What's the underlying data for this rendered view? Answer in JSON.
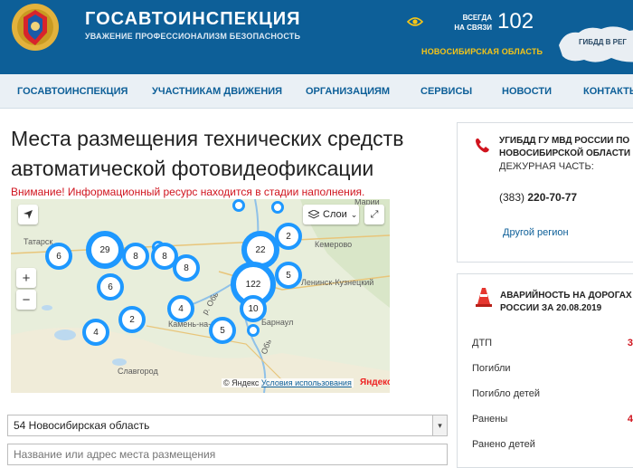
{
  "header": {
    "title": "ГОСАВТОИНСПЕКЦИЯ",
    "subtitle": "УВАЖЕНИЕ ПРОФЕССИОНАЛИЗМ БЕЗОПАСНОСТЬ",
    "contact_label_line1": "ВСЕГДА",
    "contact_label_line2": "НА СВЯЗИ",
    "contact_number": "102",
    "region": "НОВОСИБИРСКАЯ ОБЛАСТЬ",
    "map_caption": "ГИБДД В РЕГ"
  },
  "nav": {
    "items": [
      "ГОСАВТОИНСПЕКЦИЯ",
      "УЧАСТНИКАМ ДВИЖЕНИЯ",
      "ОРГАНИЗАЦИЯМ",
      "СЕРВИСЫ",
      "НОВОСТИ",
      "КОНТАКТЫ"
    ]
  },
  "main": {
    "title": "Места размещения технических средств автоматической фотовидеофиксации",
    "warning": "Внимание! Информационный ресурс находится в стадии наполнения."
  },
  "map": {
    "layers_label": "Слои",
    "clusters": [
      "6",
      "29",
      "8",
      "8",
      "8",
      "22",
      "2",
      "6",
      "122",
      "5",
      "4",
      "2",
      "10",
      "4",
      "5"
    ],
    "places": [
      "Татарск",
      "Кемерово",
      "Ленинск-Кузнецкий",
      "Барнаул",
      "Камень-на-О",
      "Славгород",
      "р. Обь",
      "Обь",
      "Марии"
    ],
    "copyright": "© Яндекс",
    "terms": "Условия использования",
    "logo": "Яндекс"
  },
  "filters": {
    "region_selected": "54 Новосибирская область",
    "place_placeholder": "Название или адрес места размещения"
  },
  "contact_card": {
    "org_name": "УГИБДД ГУ МВД РОССИИ ПО НОВОСИБИРСКОЙ ОБЛАСТИ",
    "duty_label": "ДЕЖУРНАЯ ЧАСТЬ:",
    "phone_code": "(383)",
    "phone_number": "220-70-77",
    "other_region": "Другой регион"
  },
  "stats": {
    "title": "АВАРИЙНОСТЬ НА ДОРОГАХ РОССИИ ЗА 20.08.2019",
    "rows": [
      {
        "label": "ДТП",
        "value": "3"
      },
      {
        "label": "Погибли",
        "value": ""
      },
      {
        "label": "Погибло детей",
        "value": ""
      },
      {
        "label": "Ранены",
        "value": "4"
      },
      {
        "label": "Ранено детей",
        "value": ""
      }
    ]
  },
  "colors": {
    "brand_blue": "#0d5f98",
    "accent_yellow": "#f5c518",
    "warning_red": "#d0141e",
    "cluster_blue": "#1e98ff"
  }
}
